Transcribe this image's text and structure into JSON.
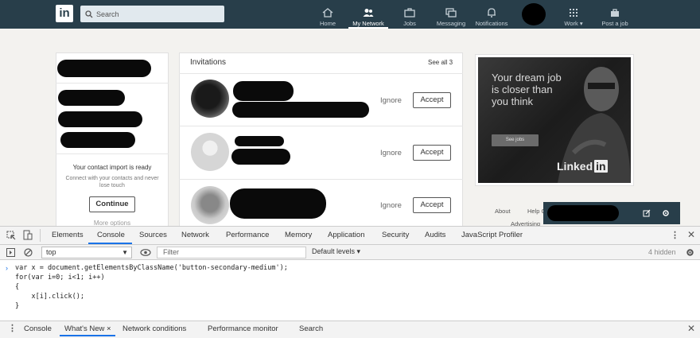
{
  "nav": {
    "search_placeholder": "Search",
    "items": [
      {
        "label": "Home",
        "icon": "home-icon"
      },
      {
        "label": "My Network",
        "icon": "network-icon"
      },
      {
        "label": "Jobs",
        "icon": "jobs-icon"
      },
      {
        "label": "Messaging",
        "icon": "messaging-icon"
      },
      {
        "label": "Notifications",
        "icon": "bell-icon"
      },
      {
        "label": "Work ▾",
        "icon": "grid-icon"
      },
      {
        "label": "Post a job",
        "icon": "briefcase-icon"
      }
    ],
    "brand_color": "#283e4a"
  },
  "left_card": {
    "import_title": "Your contact import is ready",
    "import_sub": "Connect with your contacts and never lose touch",
    "continue_label": "Continue",
    "more_options": "More options"
  },
  "invitations": {
    "title": "Invitations",
    "see_all": "See all 3",
    "ignore_label": "Ignore",
    "accept_label": "Accept"
  },
  "ad": {
    "headline": "Your dream job is closer than you think",
    "cta": "See jobs",
    "brand_word": "Linked",
    "brand_in": "in"
  },
  "footer": {
    "about": "About",
    "help": "Help C",
    "advertising": "Advertising"
  },
  "devtools": {
    "tabs": [
      "Elements",
      "Console",
      "Sources",
      "Network",
      "Performance",
      "Memory",
      "Application",
      "Security",
      "Audits",
      "JavaScript Profiler"
    ],
    "active_tab": "Console",
    "context": "top",
    "filter_placeholder": "Filter",
    "levels": "Default levels ▾",
    "hidden": "4 hidden",
    "console_lines": [
      "var x = document.getElementsByClassName('button-secondary-medium');",
      "for(var i=0; i<1; i++)",
      "{",
      "    x[i].click();",
      "}"
    ],
    "drawer_tabs": [
      "Console",
      "What's New ×",
      "Network conditions",
      "Performance monitor",
      "Search"
    ],
    "accent": "#1a73e8"
  }
}
